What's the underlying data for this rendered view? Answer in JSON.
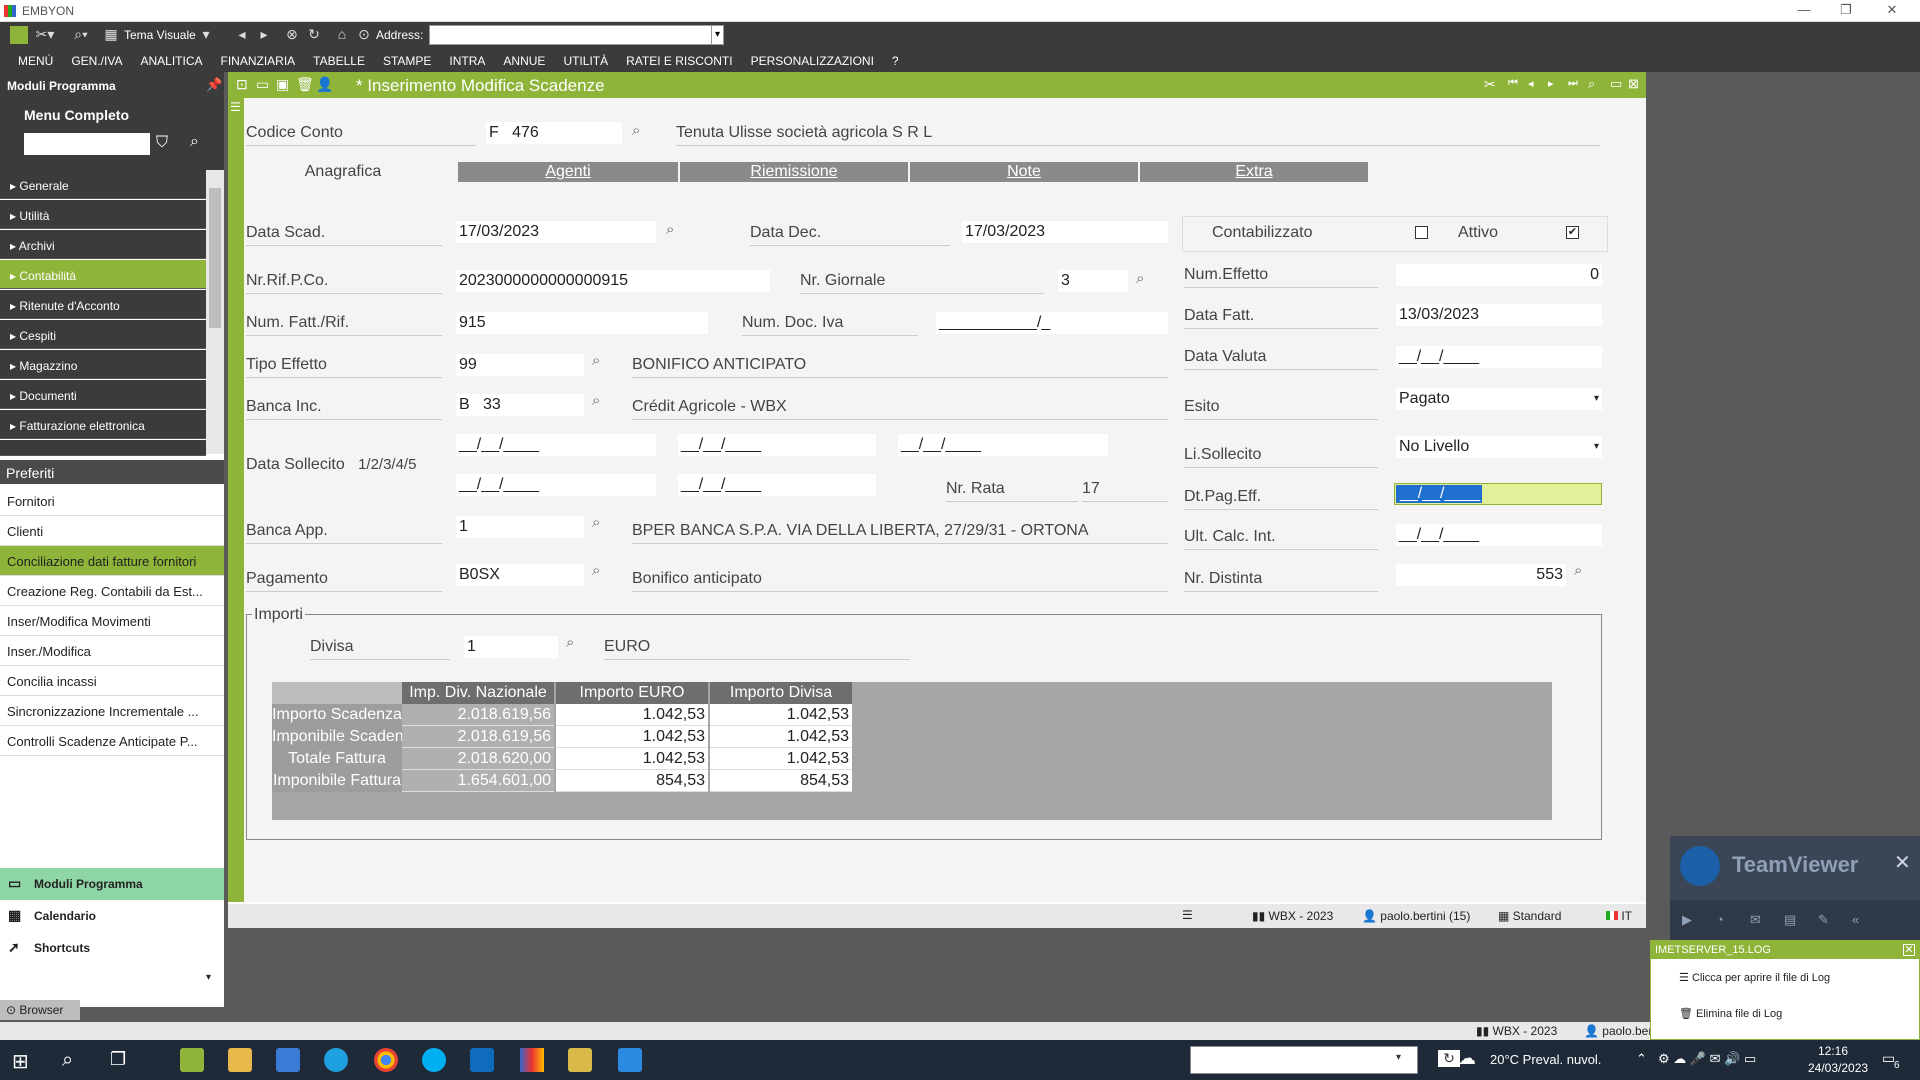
{
  "app": {
    "title": "EMBYON"
  },
  "toolbar": {
    "theme_label": "Tema Visuale",
    "address_label": "Address:"
  },
  "menu": [
    "MENÙ",
    "GEN./IVA",
    "ANALITICA",
    "FINANZIARIA",
    "TABELLE",
    "STAMPE",
    "INTRA",
    "ANNUE",
    "UTILITÀ",
    "RATEI E RISCONTI",
    "PERSONALIZZAZIONI",
    "?"
  ],
  "left": {
    "header": "Moduli Programma",
    "menu_title": "Menu Completo",
    "nav": [
      "Generale",
      "Utilità",
      "Archivi",
      "Contabilità",
      "Ritenute d'Acconto",
      "Cespiti",
      "Magazzino",
      "Documenti",
      "Fatturazione elettronica"
    ],
    "selected_nav": 3,
    "pref_header": "Preferiti",
    "prefs": [
      "Fornitori",
      "Clienti",
      "Conciliazione dati fatture fornitori",
      "Creazione Reg. Contabili da Est...",
      "Inser/Modifica Movimenti",
      "Inser./Modifica",
      "Concilia incassi",
      "Sincronizzazione Incrementale ...",
      "Controlli Scadenze Anticipate P..."
    ],
    "selected_pref": 2,
    "bottom": [
      "Moduli Programma",
      "Calendario",
      "Shortcuts"
    ],
    "browser_label": "Browser"
  },
  "window": {
    "title": "* Inserimento Modifica Scadenze"
  },
  "form": {
    "codice_conto_label": "Codice Conto",
    "codice_conto_prefix": "F",
    "codice_conto": "476",
    "ragione_sociale": "Tenuta Ulisse società agricola S R L",
    "tabs": [
      "Anagrafica",
      "Agenti",
      "Riemissione",
      "Note",
      "Extra"
    ],
    "data_scad_label": "Data Scad.",
    "data_scad": "17/03/2023",
    "data_dec_label": "Data Dec.",
    "data_dec": "17/03/2023",
    "contabilizzato_label": "Contabilizzato",
    "attivo_label": "Attivo",
    "nr_rif_label": "Nr.Rif.P.Co.",
    "nr_rif": "2023000000000000915",
    "nr_giornale_label": "Nr. Giornale",
    "nr_giornale": "3",
    "num_effetto_label": "Num.Effetto",
    "num_effetto": "0",
    "num_fatt_label": "Num. Fatt./Rif.",
    "num_fatt": "915",
    "num_doc_iva_label": "Num. Doc. Iva",
    "num_doc_iva": "___________/_",
    "data_fatt_label": "Data Fatt.",
    "data_fatt": "13/03/2023",
    "tipo_effetto_label": "Tipo Effetto",
    "tipo_effetto": "99",
    "tipo_effetto_desc": "BONIFICO ANTICIPATO",
    "data_valuta_label": "Data Valuta",
    "data_valuta": "__/__/____",
    "banca_inc_label": "Banca Inc.",
    "banca_inc_prefix": "B",
    "banca_inc": "33",
    "banca_inc_desc": "Crédit Agricole - WBX",
    "esito_label": "Esito",
    "esito": "Pagato",
    "data_sollecito_label": "Data Sollecito",
    "data_sollecito_sub": "1/2/3/4/5",
    "sollecito_dates": [
      "__/__/____",
      "__/__/____",
      "__/__/____",
      "__/__/____",
      "__/__/____"
    ],
    "li_sollecito_label": "Li.Sollecito",
    "li_sollecito": "No Livello",
    "nr_rata_label": "Nr. Rata",
    "nr_rata": "17",
    "dt_pag_eff_label": "Dt.Pag.Eff.",
    "dt_pag_eff": "__/__/____",
    "banca_app_label": "Banca App.",
    "banca_app": "1",
    "banca_app_desc": "BPER BANCA S.P.A. VIA DELLA LIBERTA, 27/29/31 - ORTONA",
    "ult_calc_label": "Ult. Calc. Int.",
    "ult_calc": "__/__/____",
    "pagamento_label": "Pagamento",
    "pagamento": "B0SX",
    "pagamento_desc": "Bonifico anticipato",
    "nr_distinta_label": "Nr. Distinta",
    "nr_distinta": "553",
    "importi_label": "Importi",
    "divisa_label": "Divisa",
    "divisa": "1",
    "divisa_desc": "EURO"
  },
  "grid": {
    "headers": [
      "Imp. Div. Nazionale",
      "Importo EURO",
      "Importo Divisa"
    ],
    "rows": [
      {
        "label": "Importo Scadenza",
        "v": [
          "2.018.619,56",
          "1.042,53",
          "1.042,53"
        ]
      },
      {
        "label": "Imponibile Scadenza",
        "v": [
          "2.018.619,56",
          "1.042,53",
          "1.042,53"
        ]
      },
      {
        "label": "Totale Fattura",
        "v": [
          "2.018.620,00",
          "1.042,53",
          "1.042,53"
        ]
      },
      {
        "label": "Imponibile Fattura",
        "v": [
          "1.654.601,00",
          "854,53",
          "854,53"
        ]
      }
    ]
  },
  "status": {
    "company": "WBX - 2023",
    "user": "paolo.bertini (15)",
    "layout": "Standard",
    "lang": "IT",
    "company2": "WBX - 2023",
    "user2": "paolo.ber"
  },
  "teamviewer": {
    "title": "TeamViewer"
  },
  "log": {
    "title": "IMETSERVER_15.LOG",
    "open": "Clicca per aprire il file di Log",
    "delete": "Elimina file di Log"
  },
  "taskbar": {
    "weather": "20°C Preval. nuvol.",
    "time": "12:16",
    "date": "24/03/2023",
    "notif": "6"
  }
}
